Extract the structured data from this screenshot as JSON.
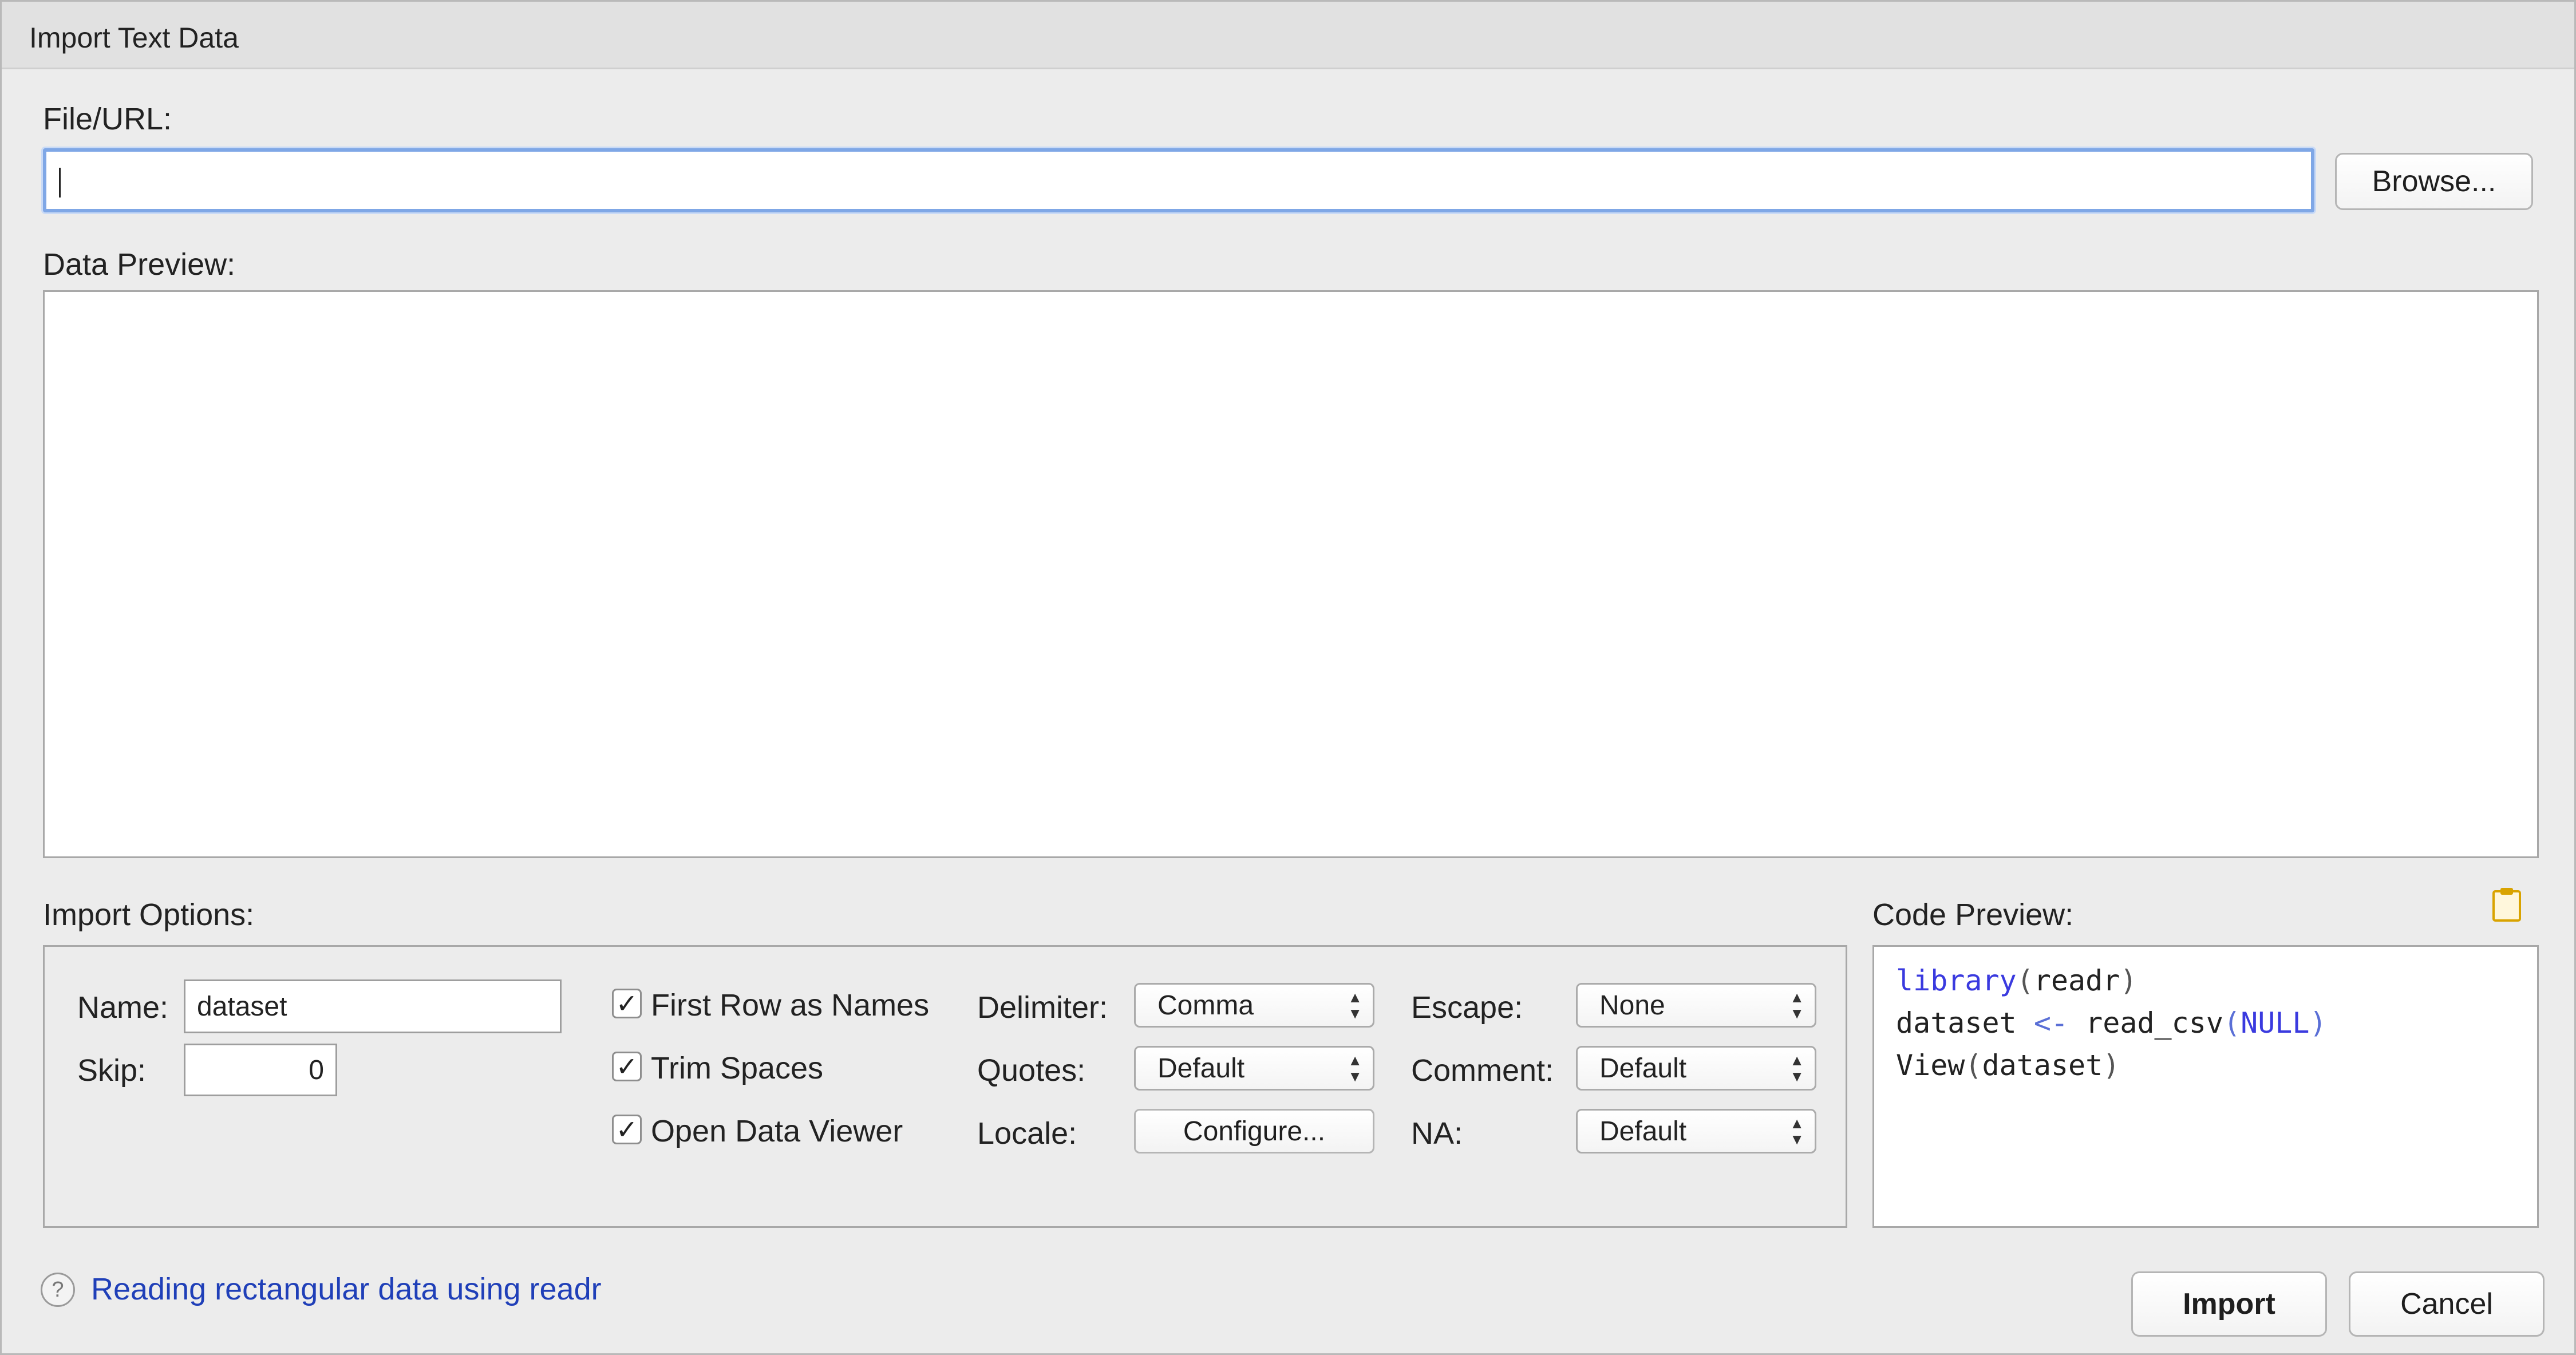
{
  "window": {
    "title": "Import Text Data"
  },
  "file_url": {
    "label": "File/URL:",
    "value": "",
    "browse_label": "Browse..."
  },
  "data_preview": {
    "label": "Data Preview:"
  },
  "import_options": {
    "label": "Import Options:",
    "name_label": "Name:",
    "name_value": "dataset",
    "skip_label": "Skip:",
    "skip_value": "0",
    "first_row_as_names": {
      "label": "First Row as Names",
      "checked": true
    },
    "trim_spaces": {
      "label": "Trim Spaces",
      "checked": true
    },
    "open_data_viewer": {
      "label": "Open Data Viewer",
      "checked": true
    },
    "delimiter_label": "Delimiter:",
    "delimiter_value": "Comma",
    "quotes_label": "Quotes:",
    "quotes_value": "Default",
    "locale_label": "Locale:",
    "locale_button": "Configure...",
    "escape_label": "Escape:",
    "escape_value": "None",
    "comment_label": "Comment:",
    "comment_value": "Default",
    "na_label": "NA:",
    "na_value": "Default"
  },
  "code_preview": {
    "label": "Code Preview:",
    "line1": {
      "fn": "library",
      "open": "(",
      "arg": "readr",
      "close": ")"
    },
    "line2": {
      "lhs": "dataset ",
      "op": "<-",
      "fn": " read_csv",
      "open": "(",
      "arg": "NULL",
      "close": ")"
    },
    "line3": {
      "fn": "View",
      "open": "(",
      "arg": "dataset",
      "close": ")"
    }
  },
  "footer": {
    "help_link": "Reading rectangular data using readr",
    "import_label": "Import",
    "cancel_label": "Cancel"
  },
  "colors": {
    "accent": "#7fa7e6",
    "link": "#1f3fb8",
    "keyword": "#3a3adf"
  }
}
